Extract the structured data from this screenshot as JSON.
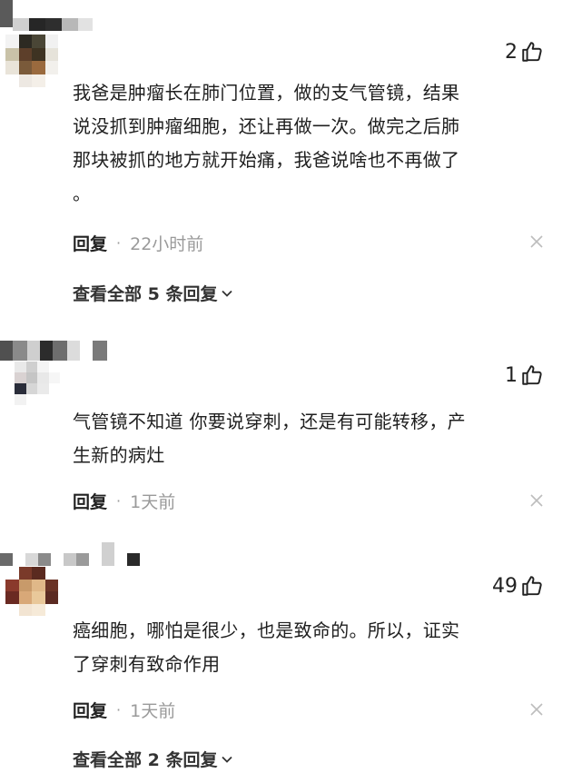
{
  "comments": [
    {
      "likes": "2",
      "text_lines": [
        "我爸是肿瘤长在肺门位置，做的支气管镜，结果",
        "说没抓到肿瘤细胞，还让再做一次。做完之后肺",
        "那块被抓的地方就开始痛，我爸说啥也不再做了",
        "。"
      ],
      "reply_label": "回复",
      "time": "22小时前",
      "view_all": "查看全部 5 条回复"
    },
    {
      "likes": "1",
      "text_lines": [
        "气管镜不知道 你要说穿刺，还是有可能转移，产",
        "生新的病灶"
      ],
      "reply_label": "回复",
      "time": "1天前"
    },
    {
      "likes": "49",
      "text_lines": [
        "癌细胞，哪怕是很少，也是致命的。所以，证实",
        "了穿刺有致命作用"
      ],
      "reply_label": "回复",
      "time": "1天前",
      "view_all": "查看全部 2 条回复"
    }
  ],
  "icons": {
    "like": "thumbs-up-icon",
    "dismiss": "close-icon",
    "expand": "chevron-down-icon"
  },
  "colors": {
    "text": "#1f1f1f",
    "muted": "#9a9a9a",
    "icon": "#bdbdbd"
  }
}
